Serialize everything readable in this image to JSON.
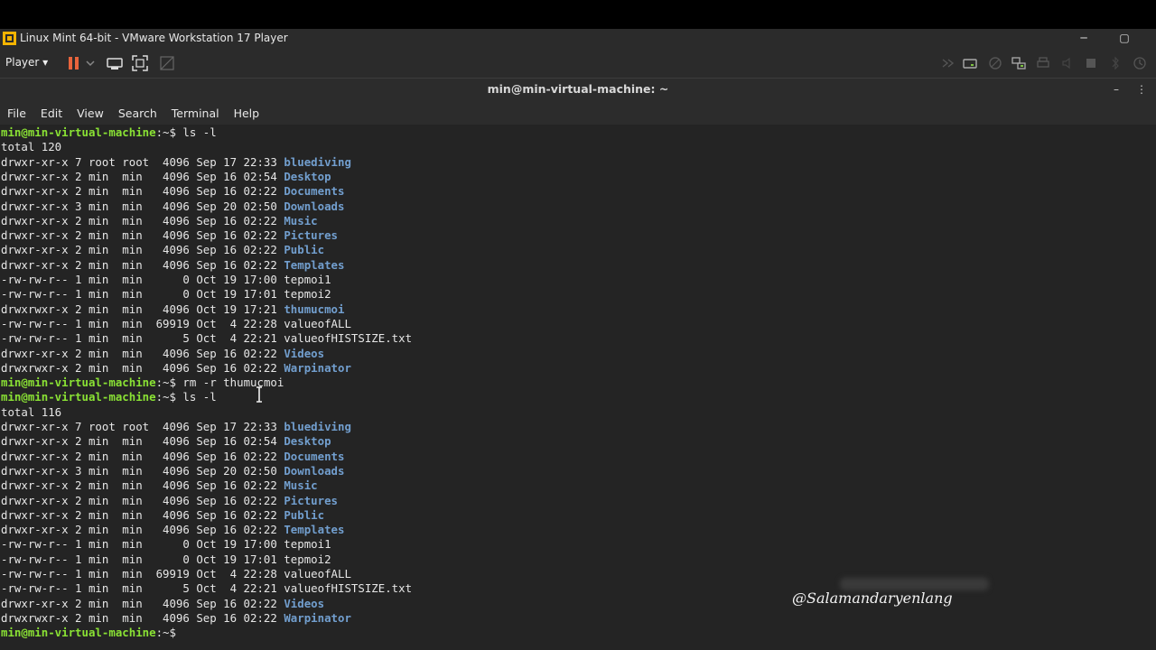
{
  "window": {
    "title": "Linux Mint 64-bit - VMware Workstation 17 Player",
    "minimize": "─",
    "maximize": "▢"
  },
  "toolbar": {
    "player_label": "Player ▾"
  },
  "terminal": {
    "title": "min@min-virtual-machine: ~",
    "minimize": "–",
    "menu_dots": "⋮",
    "menu": [
      "File",
      "Edit",
      "View",
      "Search",
      "Terminal",
      "Help"
    ],
    "lines": [
      {
        "prompt": "min@min-virtual-machine",
        "path": ":~$",
        "cmd": " ls -l"
      },
      {
        "text": "total 120"
      },
      {
        "text": "drwxr-xr-x 7 root root  4096 Sep 17 22:33 ",
        "dir": "bluediving"
      },
      {
        "text": "drwxr-xr-x 2 min  min   4096 Sep 16 02:54 ",
        "dir": "Desktop"
      },
      {
        "text": "drwxr-xr-x 2 min  min   4096 Sep 16 02:22 ",
        "dir": "Documents"
      },
      {
        "text": "drwxr-xr-x 3 min  min   4096 Sep 20 02:50 ",
        "dir": "Downloads"
      },
      {
        "text": "drwxr-xr-x 2 min  min   4096 Sep 16 02:22 ",
        "dir": "Music"
      },
      {
        "text": "drwxr-xr-x 2 min  min   4096 Sep 16 02:22 ",
        "dir": "Pictures"
      },
      {
        "text": "drwxr-xr-x 2 min  min   4096 Sep 16 02:22 ",
        "dir": "Public"
      },
      {
        "text": "drwxr-xr-x 2 min  min   4096 Sep 16 02:22 ",
        "dir": "Templates"
      },
      {
        "text": "-rw-rw-r-- 1 min  min      0 Oct 19 17:00 tepmoi1"
      },
      {
        "text": "-rw-rw-r-- 1 min  min      0 Oct 19 17:01 tepmoi2"
      },
      {
        "text": "drwxrwxr-x 2 min  min   4096 Oct 19 17:21 ",
        "dir": "thumucmoi"
      },
      {
        "text": "-rw-rw-r-- 1 min  min  69919 Oct  4 22:28 valueofALL"
      },
      {
        "text": "-rw-rw-r-- 1 min  min      5 Oct  4 22:21 valueofHISTSIZE.txt"
      },
      {
        "text": "drwxr-xr-x 2 min  min   4096 Sep 16 02:22 ",
        "dir": "Videos"
      },
      {
        "text": "drwxrwxr-x 2 min  min   4096 Sep 16 02:22 ",
        "dir": "Warpinator"
      },
      {
        "prompt": "min@min-virtual-machine",
        "path": ":~$",
        "cmd": " rm -r thumucmoi"
      },
      {
        "prompt": "min@min-virtual-machine",
        "path": ":~$",
        "cmd": " ls -l"
      },
      {
        "text": "total 116"
      },
      {
        "text": "drwxr-xr-x 7 root root  4096 Sep 17 22:33 ",
        "dir": "bluediving"
      },
      {
        "text": "drwxr-xr-x 2 min  min   4096 Sep 16 02:54 ",
        "dir": "Desktop"
      },
      {
        "text": "drwxr-xr-x 2 min  min   4096 Sep 16 02:22 ",
        "dir": "Documents"
      },
      {
        "text": "drwxr-xr-x 3 min  min   4096 Sep 20 02:50 ",
        "dir": "Downloads"
      },
      {
        "text": "drwxr-xr-x 2 min  min   4096 Sep 16 02:22 ",
        "dir": "Music"
      },
      {
        "text": "drwxr-xr-x 2 min  min   4096 Sep 16 02:22 ",
        "dir": "Pictures"
      },
      {
        "text": "drwxr-xr-x 2 min  min   4096 Sep 16 02:22 ",
        "dir": "Public"
      },
      {
        "text": "drwxr-xr-x 2 min  min   4096 Sep 16 02:22 ",
        "dir": "Templates"
      },
      {
        "text": "-rw-rw-r-- 1 min  min      0 Oct 19 17:00 tepmoi1"
      },
      {
        "text": "-rw-rw-r-- 1 min  min      0 Oct 19 17:01 tepmoi2"
      },
      {
        "text": "-rw-rw-r-- 1 min  min  69919 Oct  4 22:28 valueofALL"
      },
      {
        "text": "-rw-rw-r-- 1 min  min      5 Oct  4 22:21 valueofHISTSIZE.txt"
      },
      {
        "text": "drwxr-xr-x 2 min  min   4096 Sep 16 02:22 ",
        "dir": "Videos"
      },
      {
        "text": "drwxrwxr-x 2 min  min   4096 Sep 16 02:22 ",
        "dir": "Warpinator"
      },
      {
        "prompt": "min@min-virtual-machine",
        "path": ":~$",
        "cmd": ""
      }
    ]
  },
  "watermark": "@Salamandaryenlang",
  "colors": {
    "prompt": "#8ae234",
    "directory": "#729fcf",
    "pause_button": "#e8643c"
  }
}
